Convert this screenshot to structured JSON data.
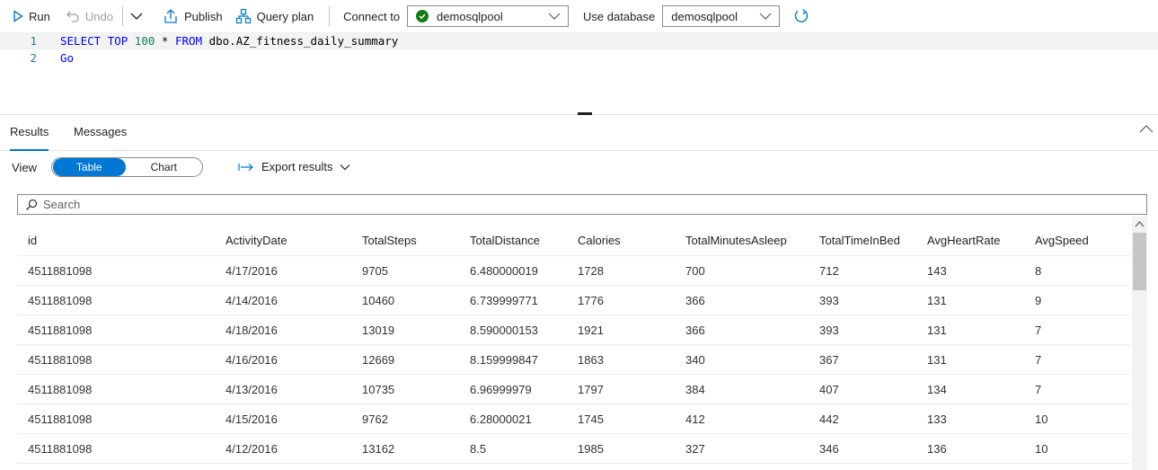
{
  "toolbar": {
    "run_label": "Run",
    "undo_label": "Undo",
    "publish_label": "Publish",
    "query_plan_label": "Query plan",
    "connect_to_label": "Connect to",
    "connect_to_value": "demosqlpool",
    "use_database_label": "Use database",
    "use_database_value": "demosqlpool"
  },
  "editor": {
    "lines": [
      {
        "number": "1",
        "tokens": [
          "SELECT",
          "TOP",
          "100",
          "*",
          "FROM",
          "dbo.AZ_fitness_daily_summary"
        ]
      },
      {
        "number": "2",
        "tokens": [
          "Go"
        ]
      }
    ]
  },
  "results": {
    "tabs": [
      "Results",
      "Messages"
    ],
    "active_tab": "Results",
    "view_label": "View",
    "view_options": [
      "Table",
      "Chart"
    ],
    "view_selected": "Table",
    "export_label": "Export results",
    "search_placeholder": "Search"
  },
  "grid": {
    "columns": [
      "id",
      "ActivityDate",
      "TotalSteps",
      "TotalDistance",
      "Calories",
      "TotalMinutesAsleep",
      "TotalTimeInBed",
      "AvgHeartRate",
      "AvgSpeed"
    ],
    "rows": [
      [
        "4511881098",
        "4/17/2016",
        "9705",
        "6.480000019",
        "1728",
        "700",
        "712",
        "143",
        "8"
      ],
      [
        "4511881098",
        "4/14/2016",
        "10460",
        "6.739999771",
        "1776",
        "366",
        "393",
        "131",
        "9"
      ],
      [
        "4511881098",
        "4/18/2016",
        "13019",
        "8.590000153",
        "1921",
        "366",
        "393",
        "131",
        "7"
      ],
      [
        "4511881098",
        "4/16/2016",
        "12669",
        "8.159999847",
        "1863",
        "340",
        "367",
        "131",
        "7"
      ],
      [
        "4511881098",
        "4/13/2016",
        "10735",
        "6.96999979",
        "1797",
        "384",
        "407",
        "134",
        "7"
      ],
      [
        "4511881098",
        "4/15/2016",
        "9762",
        "6.28000021",
        "1745",
        "412",
        "442",
        "133",
        "10"
      ],
      [
        "4511881098",
        "4/12/2016",
        "13162",
        "8.5",
        "1985",
        "327",
        "346",
        "136",
        "10"
      ]
    ]
  },
  "colors": {
    "accent": "#0078d4",
    "connected": "#107c10",
    "keyword": "#0000ff",
    "number": "#098658"
  }
}
